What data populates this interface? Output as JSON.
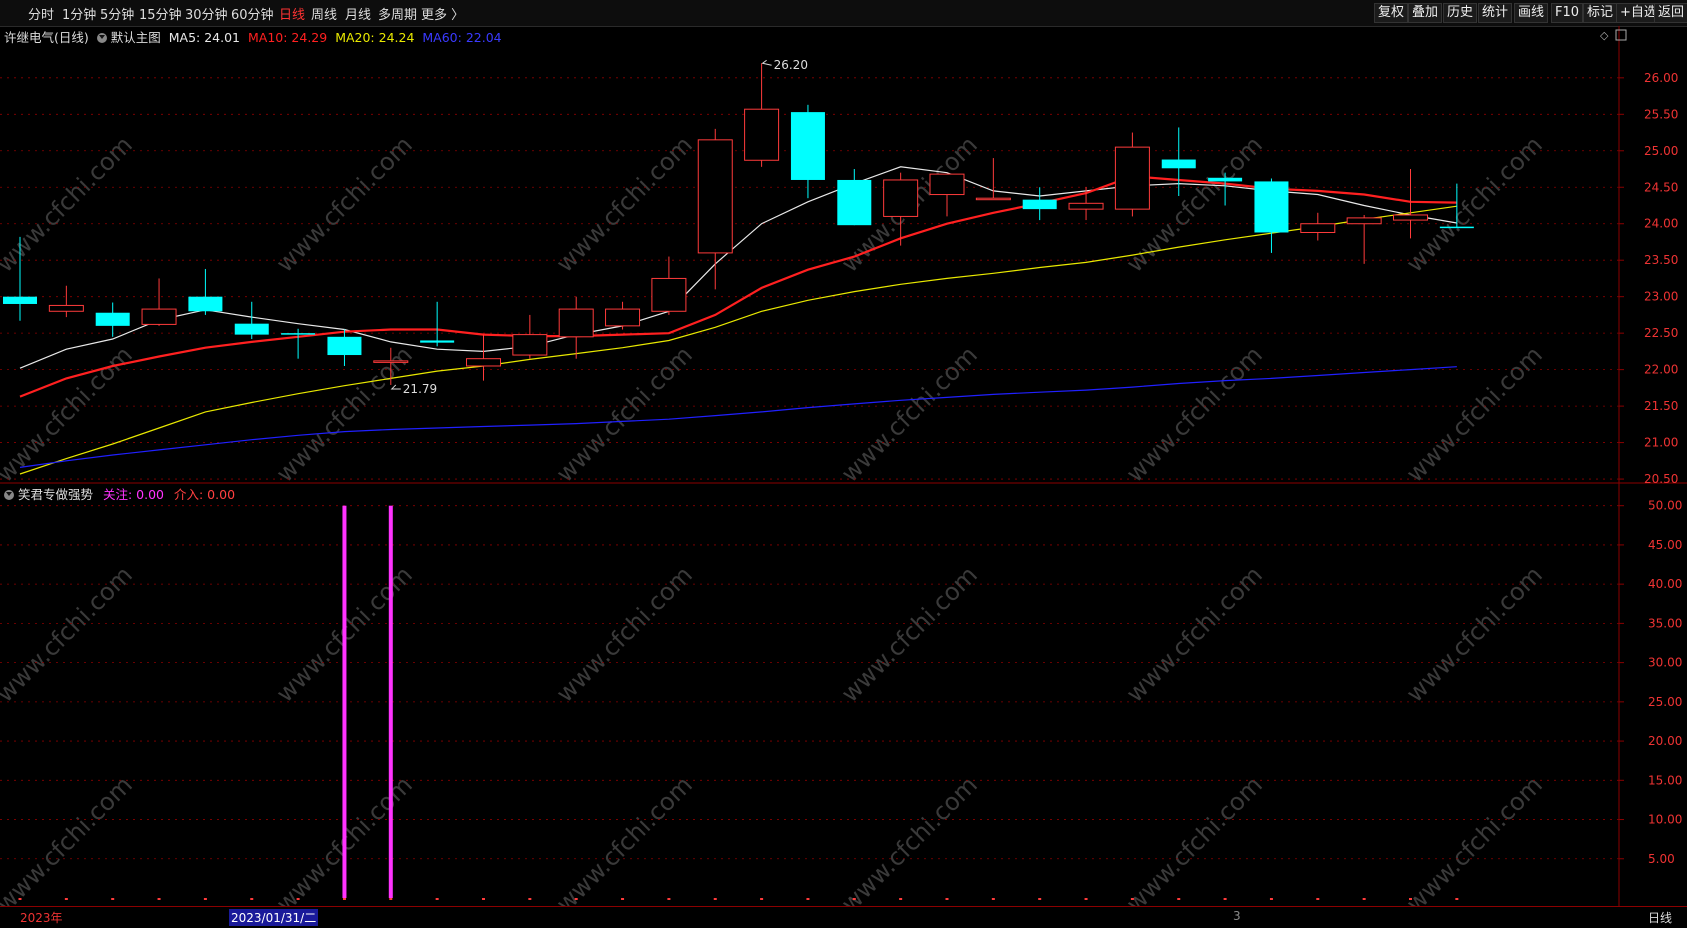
{
  "toolbar": {
    "periods": [
      {
        "label": "分时",
        "active": false
      },
      {
        "label": "1分钟",
        "active": false
      },
      {
        "label": "5分钟",
        "active": false
      },
      {
        "label": "15分钟",
        "active": false
      },
      {
        "label": "30分钟",
        "active": false
      },
      {
        "label": "60分钟",
        "active": false
      },
      {
        "label": "日线",
        "active": true
      },
      {
        "label": "周线",
        "active": false
      },
      {
        "label": "月线",
        "active": false
      },
      {
        "label": "多周期",
        "active": false
      },
      {
        "label": "更多 〉",
        "active": false
      }
    ],
    "buttons": [
      "复权",
      "叠加",
      "历史",
      "统计",
      "画线",
      "F10",
      "标记",
      "+自选",
      "返回"
    ]
  },
  "main_legend": {
    "stock": "许继电气(日线)",
    "template": "默认主图",
    "ma5": "MA5: 24.01",
    "ma10": "MA10: 24.29",
    "ma20": "MA20: 24.24",
    "ma60": "MA60: 22.04"
  },
  "sub_legend": {
    "indicator": "笑君专做强势",
    "focus": "关注: 0.00",
    "intervene": "介入: 0.00"
  },
  "colors": {
    "up": "#ff3b3b",
    "down": "#00ffff",
    "ma5": "#e8e8e8",
    "ma10": "#ff2020",
    "ma20": "#e8e800",
    "ma60": "#2020ff",
    "grid": "#8b0000",
    "signal": "#ff33ff"
  },
  "annotations": {
    "high": "26.20",
    "low": "21.79"
  },
  "bottom": {
    "year": "2023年",
    "cursor_date": "2023/01/31/二",
    "month_mark": "3",
    "period": "日线"
  },
  "watermark": "www.cfchi.com",
  "chart_data": [
    {
      "type": "candlestick",
      "title": "许继电气(日线)",
      "ylim": [
        20.35,
        26.45
      ],
      "yticks": [
        "20.50",
        "21.00",
        "21.50",
        "22.00",
        "22.50",
        "23.00",
        "23.50",
        "24.00",
        "24.50",
        "25.00",
        "25.50",
        "26.00"
      ],
      "candles": [
        {
          "o": 23.0,
          "h": 23.82,
          "l": 22.67,
          "c": 22.9
        },
        {
          "o": 22.8,
          "h": 23.15,
          "l": 22.72,
          "c": 22.88
        },
        {
          "o": 22.78,
          "h": 22.92,
          "l": 22.45,
          "c": 22.6
        },
        {
          "o": 22.62,
          "h": 23.25,
          "l": 22.6,
          "c": 22.83
        },
        {
          "o": 23.0,
          "h": 23.38,
          "l": 22.75,
          "c": 22.8
        },
        {
          "o": 22.63,
          "h": 22.93,
          "l": 22.42,
          "c": 22.48
        },
        {
          "o": 22.5,
          "h": 22.56,
          "l": 22.15,
          "c": 22.48
        },
        {
          "o": 22.45,
          "h": 22.55,
          "l": 22.05,
          "c": 22.2
        },
        {
          "o": 22.12,
          "h": 22.3,
          "l": 21.79,
          "c": 22.12
        },
        {
          "o": 22.4,
          "h": 22.93,
          "l": 22.32,
          "c": 22.37
        },
        {
          "o": 22.05,
          "h": 22.48,
          "l": 21.85,
          "c": 22.15
        },
        {
          "o": 22.2,
          "h": 22.75,
          "l": 22.15,
          "c": 22.48
        },
        {
          "o": 22.45,
          "h": 23.0,
          "l": 22.15,
          "c": 22.83
        },
        {
          "o": 22.6,
          "h": 22.93,
          "l": 22.55,
          "c": 22.83
        },
        {
          "o": 22.8,
          "h": 23.55,
          "l": 22.75,
          "c": 23.25
        },
        {
          "o": 23.6,
          "h": 25.3,
          "l": 23.1,
          "c": 25.15
        },
        {
          "o": 24.87,
          "h": 26.2,
          "l": 24.78,
          "c": 25.57
        },
        {
          "o": 25.53,
          "h": 25.63,
          "l": 24.35,
          "c": 24.6
        },
        {
          "o": 24.6,
          "h": 24.75,
          "l": 23.98,
          "c": 23.98
        },
        {
          "o": 24.1,
          "h": 24.7,
          "l": 23.7,
          "c": 24.6
        },
        {
          "o": 24.4,
          "h": 24.68,
          "l": 24.1,
          "c": 24.68
        },
        {
          "o": 24.35,
          "h": 24.9,
          "l": 24.35,
          "c": 24.35
        },
        {
          "o": 24.33,
          "h": 24.5,
          "l": 24.05,
          "c": 24.2
        },
        {
          "o": 24.2,
          "h": 24.5,
          "l": 24.05,
          "c": 24.28
        },
        {
          "o": 24.2,
          "h": 25.25,
          "l": 24.1,
          "c": 25.05
        },
        {
          "o": 24.88,
          "h": 25.32,
          "l": 24.38,
          "c": 24.76
        },
        {
          "o": 24.63,
          "h": 24.7,
          "l": 24.25,
          "c": 24.58
        },
        {
          "o": 24.58,
          "h": 24.62,
          "l": 23.6,
          "c": 23.88
        },
        {
          "o": 23.88,
          "h": 24.15,
          "l": 23.77,
          "c": 24.0
        },
        {
          "o": 24.0,
          "h": 24.12,
          "l": 23.45,
          "c": 24.08
        },
        {
          "o": 24.05,
          "h": 24.75,
          "l": 23.8,
          "c": 24.12
        },
        {
          "o": 23.96,
          "h": 24.55,
          "l": 23.94,
          "c": 23.94
        }
      ],
      "series": [
        {
          "name": "MA5",
          "values": [
            22.02,
            22.28,
            22.42,
            22.68,
            22.82,
            22.72,
            22.63,
            22.55,
            22.38,
            22.28,
            22.25,
            22.32,
            22.48,
            22.6,
            22.8,
            23.45,
            24.0,
            24.3,
            24.55,
            24.78,
            24.7,
            24.45,
            24.38,
            24.45,
            24.52,
            24.55,
            24.52,
            24.45,
            24.4,
            24.25,
            24.12,
            24.01
          ]
        },
        {
          "name": "MA10",
          "values": [
            21.63,
            21.88,
            22.05,
            22.18,
            22.3,
            22.38,
            22.45,
            22.52,
            22.55,
            22.55,
            22.48,
            22.46,
            22.46,
            22.48,
            22.5,
            22.75,
            23.12,
            23.37,
            23.55,
            23.8,
            24.0,
            24.15,
            24.28,
            24.42,
            24.65,
            24.6,
            24.55,
            24.48,
            24.45,
            24.4,
            24.3,
            24.29
          ]
        },
        {
          "name": "MA20",
          "values": [
            20.57,
            20.78,
            20.98,
            21.2,
            21.42,
            21.55,
            21.67,
            21.78,
            21.88,
            21.98,
            22.05,
            22.14,
            22.22,
            22.3,
            22.4,
            22.58,
            22.8,
            22.95,
            23.07,
            23.17,
            23.25,
            23.32,
            23.4,
            23.47,
            23.57,
            23.68,
            23.78,
            23.87,
            23.96,
            24.06,
            24.15,
            24.24
          ]
        },
        {
          "name": "MA60",
          "values": [
            20.66,
            20.75,
            20.83,
            20.9,
            20.97,
            21.04,
            21.1,
            21.15,
            21.18,
            21.2,
            21.22,
            21.24,
            21.26,
            21.29,
            21.32,
            21.37,
            21.42,
            21.48,
            21.53,
            21.58,
            21.62,
            21.66,
            21.69,
            21.72,
            21.76,
            21.81,
            21.85,
            21.88,
            21.92,
            21.96,
            22.0,
            22.04
          ]
        }
      ]
    },
    {
      "type": "bar",
      "title": "笑君专做强势",
      "ylim": [
        0,
        52
      ],
      "yticks": [
        "5.00",
        "10.00",
        "15.00",
        "20.00",
        "25.00",
        "30.00",
        "35.00",
        "40.00",
        "45.00",
        "50.00"
      ],
      "series": [
        {
          "name": "关注",
          "values": [
            0,
            0,
            0,
            0,
            0,
            0,
            0,
            50,
            50,
            0,
            0,
            0,
            0,
            0,
            0,
            0,
            0,
            0,
            0,
            0,
            0,
            0,
            0,
            0,
            0,
            0,
            0,
            0,
            0,
            0,
            0,
            0
          ]
        }
      ]
    }
  ]
}
